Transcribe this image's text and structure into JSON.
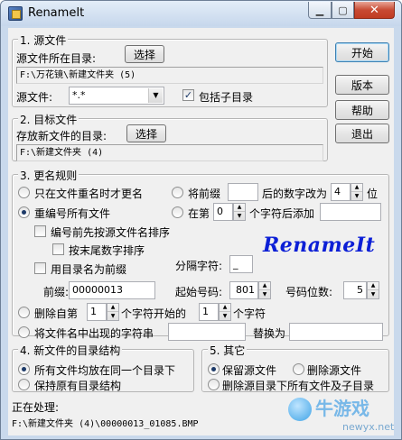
{
  "window": {
    "title": "RenameIt"
  },
  "source": {
    "legend": "1. 源文件",
    "dir_label": "源文件所在目录:",
    "select_button": "选择",
    "dir_path": "F:\\万花镜\\新建文件夹 (5)",
    "file_label": "源文件:",
    "file_pattern": "*.*",
    "include_subdirs_label": "包括子目录",
    "include_subdirs_checked": true
  },
  "target": {
    "legend": "2. 目标文件",
    "dir_label": "存放新文件的目录:",
    "select_button": "选择",
    "dir_path": "F:\\新建文件夹 (4)"
  },
  "rules": {
    "legend": "3. 更名规则",
    "opt_only_duplicates": "只在文件重名时才更名",
    "opt_prefix_digits": "将前缀",
    "prefix_digits_value": "",
    "prefix_digits_mid": "后的数字改为",
    "prefix_digits_count": "4",
    "prefix_digits_unit": "位",
    "opt_renumber_all": "重编号所有文件",
    "opt_insert_at": "在第",
    "insert_pos": "0",
    "insert_after_text": "个字符后添加",
    "insert_value": "",
    "chk_sort_by_name": "编号前先按源文件名排序",
    "chk_sort_by_ext": "按末尾数字排序",
    "chk_dir_prefix": "用目录名为前缀",
    "separator_label": "分隔字符:",
    "separator_value": "_",
    "prefix_label": "前缀:",
    "prefix_value": "00000013",
    "start_label": "起始号码:",
    "start_value": "801",
    "digits_label": "号码位数:",
    "digits_value": "5",
    "opt_delete_from": "删除自第",
    "delete_from_value": "1",
    "delete_mid": "个字符开始的",
    "delete_count": "1",
    "delete_unit": "个字符",
    "opt_replace": "将文件名中出现的字符串",
    "replace_find": "",
    "replace_with_label": "替换为",
    "replace_with": ""
  },
  "logo_text": "RenameIt",
  "dir_structure": {
    "legend": "4. 新文件的目录结构",
    "opt_same_dir": "所有文件均放在同一个目录下",
    "opt_keep_structure": "保持原有目录结构"
  },
  "other": {
    "legend": "5. 其它",
    "opt_keep_source": "保留源文件",
    "opt_delete_source": "删除源文件",
    "opt_delete_all": "删除源目录下所有文件及子目录"
  },
  "status": {
    "label": "正在处理:",
    "path": "F:\\新建文件夹 (4)\\00000013_01085.BMP"
  },
  "buttons": {
    "start": "开始",
    "version": "版本",
    "help": "帮助",
    "exit": "退出"
  },
  "watermark": {
    "brand": "牛游戏",
    "url": "newyx.net"
  }
}
